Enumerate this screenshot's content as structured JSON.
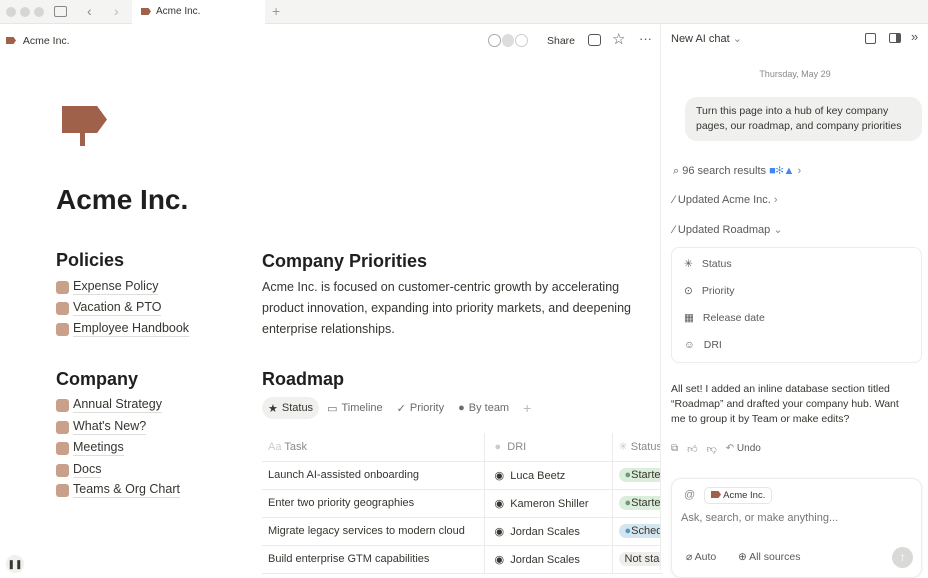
{
  "browser": {
    "tab_title": "Acme Inc.",
    "new_tab": "+"
  },
  "header": {
    "breadcrumb": "Acme Inc.",
    "share": "Share"
  },
  "page": {
    "title": "Acme Inc.",
    "policies": {
      "heading": "Policies",
      "items": [
        "Expense Policy",
        "Vacation & PTO",
        "Employee Handbook"
      ]
    },
    "company": {
      "heading": "Company",
      "items": [
        "Annual Strategy",
        "What's New?",
        "Meetings",
        "Docs",
        "Teams & Org Chart"
      ]
    },
    "priorities": {
      "heading": "Company Priorities",
      "body": "Acme Inc. is focused on customer-centric growth by accelerating product innovation, expanding into priority markets, and deepening enterprise relationships."
    },
    "roadmap": {
      "heading": "Roadmap",
      "views": [
        "Status",
        "Timeline",
        "Priority",
        "By team"
      ],
      "columns": [
        "Task",
        "DRI",
        "Status"
      ],
      "rows": [
        {
          "task": "Launch AI-assisted onboarding",
          "dri": "Luca Beetz",
          "status": "Started"
        },
        {
          "task": "Enter two priority geographies",
          "dri": "Kameron Shiller",
          "status": "Started"
        },
        {
          "task": "Migrate legacy services to modern cloud",
          "dri": "Jordan Scales",
          "status": "Scheduled"
        },
        {
          "task": "Build enterprise GTM capabilities",
          "dri": "Jordan Scales",
          "status": "Not started"
        }
      ]
    }
  },
  "chat": {
    "title": "New AI chat",
    "date": "Thursday, May 29",
    "user_message": "Turn this page into a hub of key company pages, our roadmap, and company priorities",
    "steps": [
      "96 search results",
      "Updated Acme Inc.",
      "Updated Roadmap"
    ],
    "properties": [
      "Status",
      "Priority",
      "Release date",
      "DRI"
    ],
    "reply": "All set! I added an inline database section titled “Roadmap” and drafted your company hub. Want me to group it by Team or make edits?",
    "undo": "Undo",
    "mention": "Acme Inc.",
    "placeholder": "Ask, search, or make anything...",
    "mode": "Auto",
    "sources": "All sources"
  },
  "colors": {
    "accent": "#a0614a",
    "started": "#dbeddb",
    "scheduled": "#d3e5ef",
    "not_started": "#efeeec"
  }
}
